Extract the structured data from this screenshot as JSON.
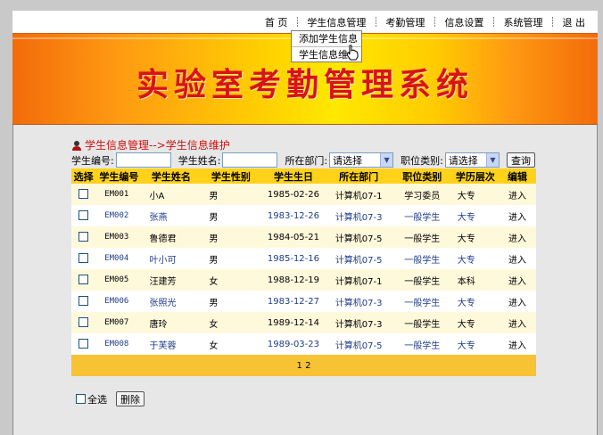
{
  "nav": {
    "items": [
      "首 页",
      "学生信息管理",
      "考勤管理",
      "信息设置",
      "系统管理",
      "退 出"
    ]
  },
  "dropdown": {
    "items": [
      "添加学生信息",
      "学生信息维护"
    ]
  },
  "banner": {
    "title": "实验室考勤管理系统"
  },
  "breadcrumb": {
    "text": "学生信息管理-->学生信息维护",
    "icon": "user-icon"
  },
  "filters": {
    "student_id_label": "学生编号:",
    "student_name_label": "学生姓名:",
    "dept_label": "所在部门:",
    "dept_value": "请选择",
    "job_label": "职位类别:",
    "job_value": "请选择",
    "query_button": "查询"
  },
  "table": {
    "headers": [
      "选择",
      "学生编号",
      "学生姓名",
      "学生性别",
      "学生生日",
      "所在部门",
      "职位类别",
      "学历层次",
      "编辑"
    ],
    "rows": [
      {
        "id": "EM001",
        "name": "小A",
        "sex": "男",
        "birthday": "1985-02-26",
        "dept": "计算机07-1",
        "job": "学习委员",
        "edu": "大专",
        "edit": "进入"
      },
      {
        "id": "EM002",
        "name": "张燕",
        "sex": "男",
        "birthday": "1983-12-26",
        "dept": "计算机07-3",
        "job": "一般学生",
        "edu": "大专",
        "edit": "进入"
      },
      {
        "id": "EM003",
        "name": "鲁德君",
        "sex": "男",
        "birthday": "1984-05-21",
        "dept": "计算机07-5",
        "job": "一般学生",
        "edu": "大专",
        "edit": "进入"
      },
      {
        "id": "EM004",
        "name": "叶小可",
        "sex": "男",
        "birthday": "1985-12-16",
        "dept": "计算机07-5",
        "job": "一般学生",
        "edu": "大专",
        "edit": "进入"
      },
      {
        "id": "EM005",
        "name": "汪建芳",
        "sex": "女",
        "birthday": "1988-12-19",
        "dept": "计算机07-1",
        "job": "一般学生",
        "edu": "本科",
        "edit": "进入"
      },
      {
        "id": "EM006",
        "name": "张照光",
        "sex": "男",
        "birthday": "1983-12-27",
        "dept": "计算机07-3",
        "job": "一般学生",
        "edu": "大专",
        "edit": "进入"
      },
      {
        "id": "EM007",
        "name": "唐玲",
        "sex": "女",
        "birthday": "1989-12-14",
        "dept": "计算机07-3",
        "job": "一般学生",
        "edu": "大专",
        "edit": "进入"
      },
      {
        "id": "EM008",
        "name": "于芙蓉",
        "sex": "女",
        "birthday": "1989-03-23",
        "dept": "计算机07-5",
        "job": "一般学生",
        "edu": "大专",
        "edit": "进入"
      }
    ],
    "pager": "1 2"
  },
  "footer": {
    "select_all_label": "全选",
    "delete_button": "删除"
  },
  "colors": {
    "title_red": "#d81414",
    "header_yellow": "#ffd21a",
    "pager_orange": "#f7c233",
    "link_blue": "#1f3c88"
  }
}
